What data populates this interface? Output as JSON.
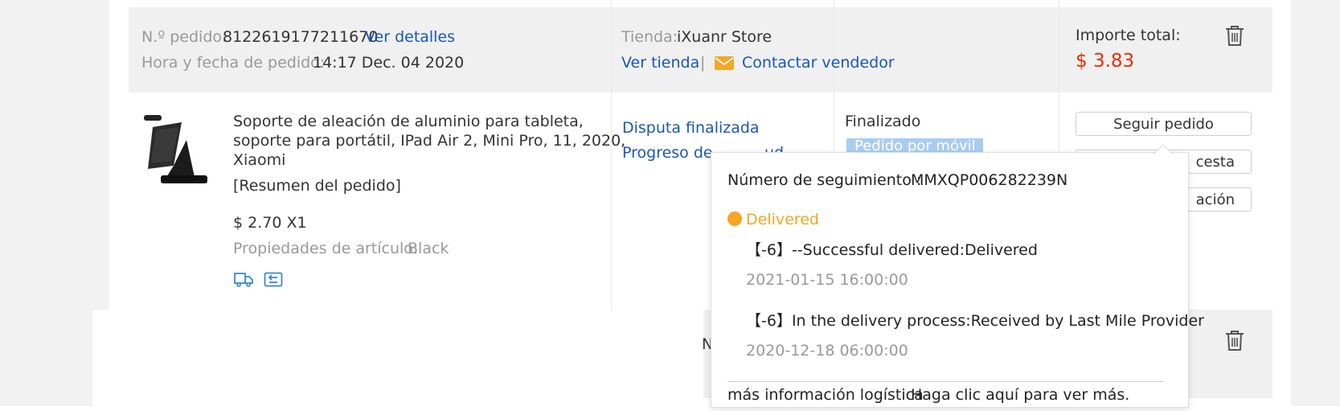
{
  "order": {
    "number_label": "N.º pedido:",
    "number_value": "8122619177211670",
    "details_link": "Ver detalles",
    "datetime_label": "Hora y fecha de pedido:",
    "datetime_value": "14:17 Dec. 04 2020",
    "store_label": "Tienda:",
    "store_value": "iXuanr Store",
    "view_store_link": "Ver tienda",
    "separator": "|",
    "contact_link": "Contactar vendedor",
    "total_label": "Importe total:",
    "total_value": "$ 3.83"
  },
  "item": {
    "title_line1": "Soporte de aleación de aluminio para tableta,",
    "title_line2": "soporte para portátil, IPad Air 2, Mini Pro, 11, 2020,",
    "title_line3": "Xiaomi",
    "summary": "[Resumen del pedido]",
    "price_qty": "$ 2.70 X1",
    "properties_label": "Propiedades de artículo:",
    "properties_value": "Black",
    "dispute_status": "Disputa finalizada",
    "dispute_progress": "Progreso de",
    "dispute_progress_tail": "ud",
    "status": "Finalizado",
    "mobile_badge": "Pedido por móvil"
  },
  "actions": {
    "track_button": "Seguir pedido",
    "add_cart_partial": "cesta",
    "review_partial": "ación"
  },
  "second_order_partial": "N",
  "tracking_popup": {
    "tracking_label": "Número de seguimiento :",
    "tracking_number": "MMXQP006282239N",
    "status": "Delivered",
    "status_color": "#f5a623",
    "events": [
      {
        "text": "【-6】--Successful delivered:Delivered",
        "time": "2021-01-15 16:00:00"
      },
      {
        "text": "【-6】In the delivery process:Received by Last Mile Provider",
        "time": "2020-12-18 06:00:00"
      }
    ],
    "more_info_label": "más información logística",
    "more_info_link": "Haga clic aquí para ver más."
  }
}
